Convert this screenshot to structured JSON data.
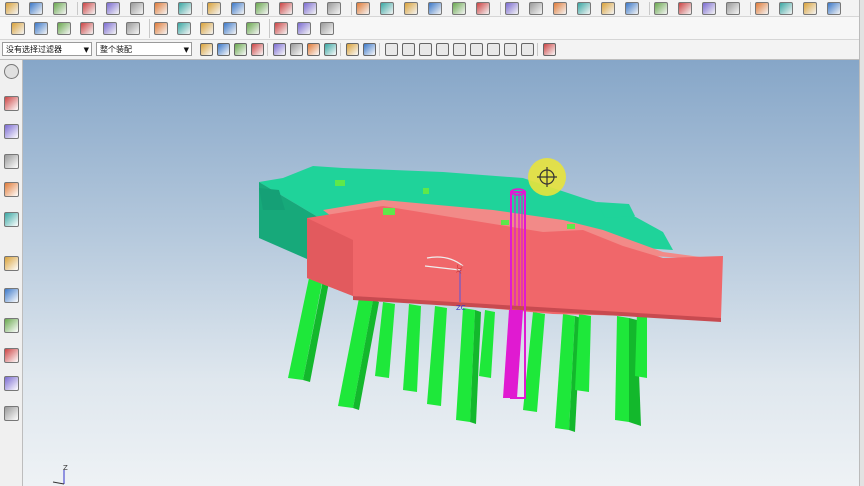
{
  "selection_bar": {
    "filter_value": "没有选择过滤器",
    "scope_value": "整个装配"
  },
  "toolbar_row1": {
    "icons": [
      "view-icon",
      "layer-icon",
      "grid-icon",
      "curve-icon",
      "arc-icon",
      "spline-icon",
      "circle-icon",
      "line-icon",
      "point-icon",
      "rectangle-icon",
      "plus-icon",
      "sketch-icon",
      "move-icon",
      "trim-icon",
      "fillet-icon",
      "mirror-icon",
      "hole-icon",
      "block-icon",
      "cylinder-icon",
      "cone-icon",
      "sphere-icon",
      "extrude-icon",
      "revolve-icon",
      "sweep-icon",
      "shell-icon",
      "draft-icon",
      "blend-icon",
      "chamfer-icon",
      "pattern-icon",
      "unite-icon",
      "subtract-icon",
      "intersect-icon",
      "analysis-icon",
      "color-icon"
    ]
  },
  "toolbar_row2": {
    "icons": [
      "line-tool-icon",
      "point-tool-icon",
      "surface-tool-icon",
      "mesh-tool-icon",
      "loft-tool-icon",
      "bridge-tool-icon",
      "offset-tool-icon",
      "thicken-tool-icon",
      "sew-tool-icon",
      "patch-tool-icon",
      "trim-body-icon",
      "split-body-icon",
      "swoop-icon",
      "mold-icon"
    ]
  },
  "toolbar_row3": {
    "icons": [
      "select-filter-icon",
      "snap-icon",
      "feature-icon",
      "edge-icon",
      "face-icon",
      "body-icon",
      "component-icon",
      "select-all-icon",
      "wireframe-icon",
      "shaded-icon",
      "end-point-icon",
      "mid-point-icon",
      "control-point-icon",
      "intersection-icon",
      "arc-center-icon",
      "quadrant-icon",
      "existing-point-icon",
      "point-on-curve-icon",
      "point-on-surface-icon",
      "settings-icon"
    ]
  },
  "left_panel": {
    "icons": [
      "settings-gear-icon",
      "assembly-navigator-icon",
      "constraint-navigator-icon",
      "part-navigator-icon",
      "reuse-library-icon",
      "hd3d-tools-icon",
      "web-browser-icon",
      "history-icon",
      "process-studio-icon",
      "roles-icon",
      "system-scene-icon",
      "print-icon"
    ]
  },
  "viewport": {
    "axis_labels": {
      "xc": "XC",
      "zc": "ZC",
      "z": "Z"
    },
    "colors": {
      "background_top": "#86a6c8",
      "plate_top": "#1fd39a",
      "plate_side": "#17a97a",
      "mold_plate": "#f0676a",
      "mold_plate_side": "#d9545a",
      "ejector_pins": "#1ee83a",
      "selected_pin": "#e01ad1",
      "cursor_highlight": "#e8e33c"
    }
  }
}
